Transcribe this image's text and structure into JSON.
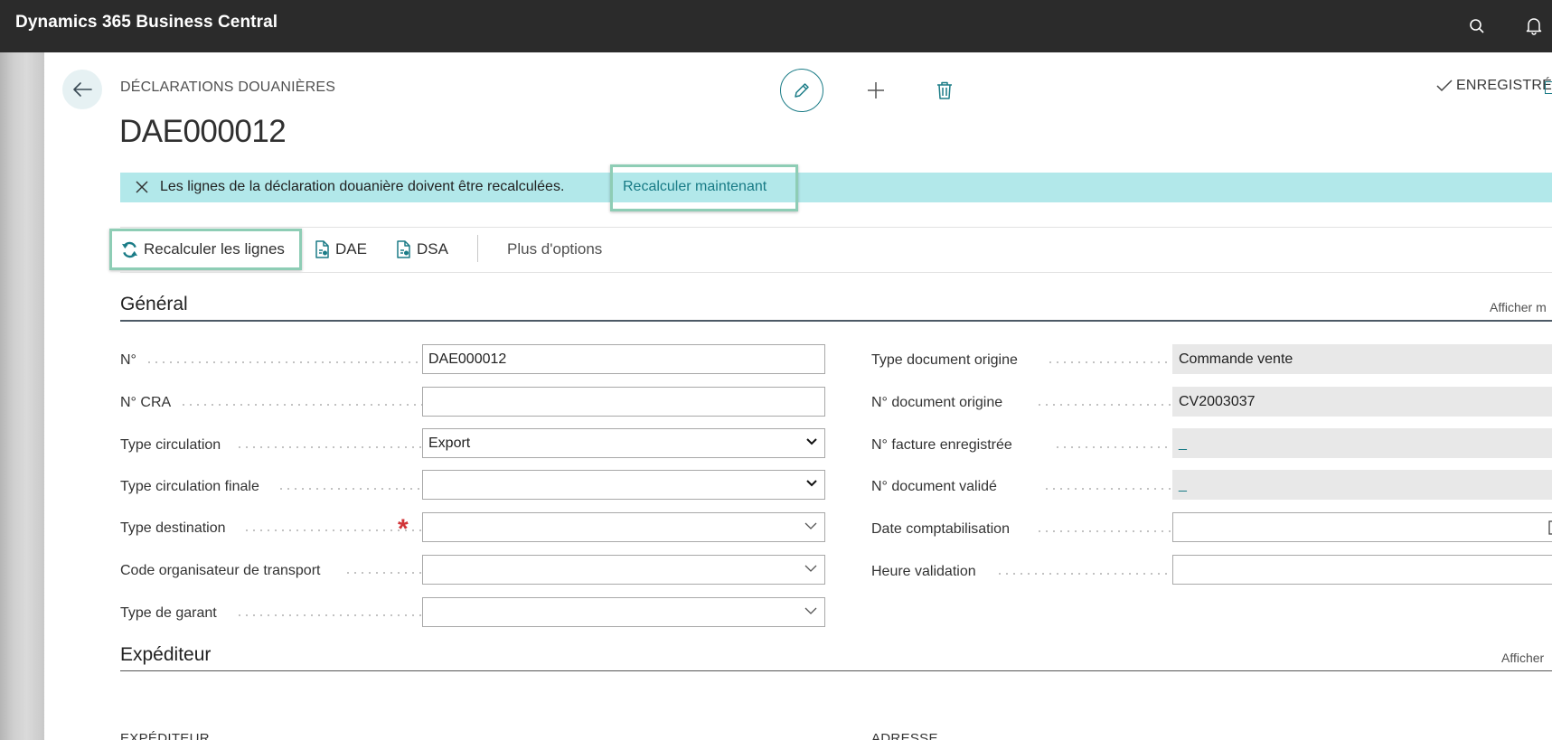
{
  "app": {
    "title": "Dynamics 365 Business Central"
  },
  "header": {
    "breadcrumb": "DÉCLARATIONS DOUANIÈRES",
    "record_title": "DAE000012",
    "saved_status": "ENREGISTRÉ"
  },
  "banner": {
    "message": "Les lignes de la déclaration douanière doivent être recalculées.",
    "action": "Recalculer maintenant"
  },
  "actions": {
    "recalc": "Recalculer les lignes",
    "dae": "DAE",
    "dsa": "DSA",
    "more": "Plus d'options"
  },
  "general": {
    "title": "Général",
    "more": "Afficher m",
    "left_fields": [
      {
        "label": "N°",
        "value": "DAE000012"
      },
      {
        "label": "N° CRA",
        "value": ""
      },
      {
        "label": "Type circulation",
        "value": "Export"
      },
      {
        "label": "Type circulation finale",
        "value": ""
      },
      {
        "label": "Type destination",
        "value": ""
      },
      {
        "label": "Code organisateur de transport",
        "value": ""
      },
      {
        "label": "Type de garant",
        "value": ""
      }
    ],
    "right_fields": [
      {
        "label": "Type document origine",
        "value": "Commande vente"
      },
      {
        "label": "N° document origine",
        "value": "CV2003037"
      },
      {
        "label": "N° facture enregistrée",
        "value": "_"
      },
      {
        "label": "N° document validé",
        "value": "_"
      },
      {
        "label": "Date comptabilisation",
        "value": ""
      },
      {
        "label": "Heure validation",
        "value": ""
      }
    ]
  },
  "sender": {
    "title": "Expéditeur",
    "more": "Afficher",
    "sub_left": "EXPÉDITEUR",
    "sub_right": "ADRESSE"
  },
  "colors": {
    "accent": "#187b86",
    "banner": "#b2e8ea",
    "topbar": "#2b2b2b",
    "highlight": "#8ecdb5",
    "required": "#d13438"
  }
}
